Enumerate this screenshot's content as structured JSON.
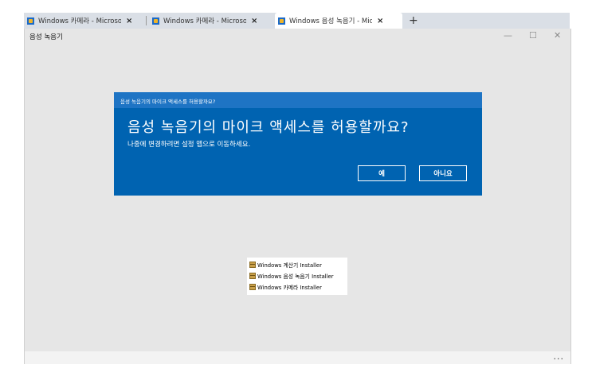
{
  "browser": {
    "tabs": [
      {
        "title": "Windows 카메라 - Microsoft A",
        "active": false
      },
      {
        "title": "Windows 카메라 - Microsoft A",
        "active": false
      },
      {
        "title": "Windows 음성 녹음기 - Micro",
        "active": true
      }
    ],
    "close_glyph": "×",
    "new_tab_glyph": "+"
  },
  "app": {
    "title": "음성 녹음기",
    "minimize_glyph": "—",
    "maximize_glyph": "☐",
    "close_glyph": "✕",
    "more_glyph": "..."
  },
  "dialog": {
    "header": "음성 녹음기의 마이크 액세스를 허용할까요?",
    "title": "음성 녹음기의 마이크 액세스를 허용할까요?",
    "message": "나중에 변경하려면 설정 앱으로 이동하세요.",
    "yes_label": "예",
    "no_label": "아니요",
    "background_color": "#0063b1"
  },
  "installers": [
    {
      "label": "Windows 계산기 Installer"
    },
    {
      "label": "Windows 음성 녹음기 Installer"
    },
    {
      "label": "Windows 카메라 Installer"
    }
  ]
}
